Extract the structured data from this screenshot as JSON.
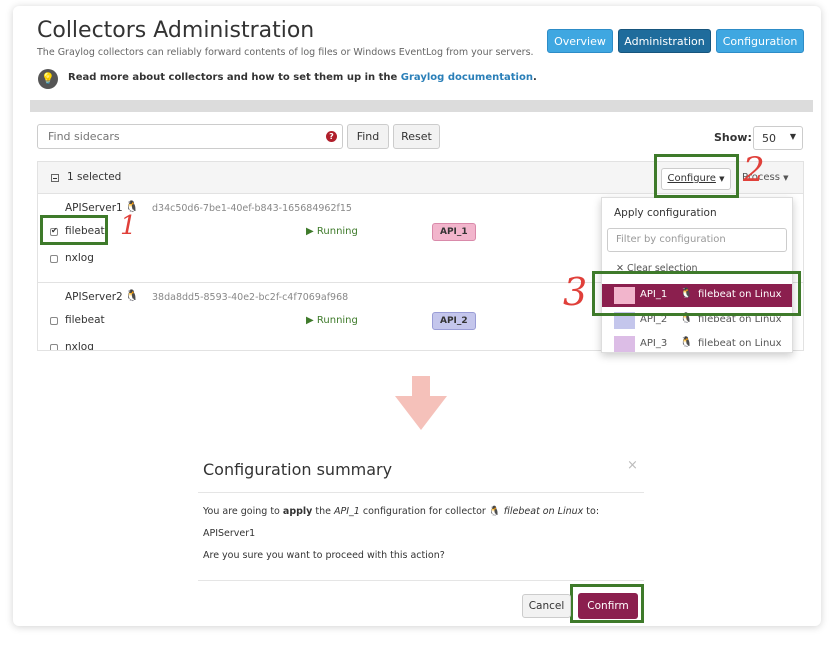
{
  "header": {
    "title": "Collectors Administration",
    "subtitle": "The Graylog collectors can reliably forward contents of log files or Windows EventLog from your servers.",
    "buttons": [
      "Overview",
      "Administration",
      "Configuration"
    ],
    "doc_text": "Read more about collectors and how to set them up in the",
    "doc_link": "Graylog documentation",
    "doc_suffix": "."
  },
  "search": {
    "placeholder": "Find sidecars",
    "find_label": "Find",
    "reset_label": "Reset"
  },
  "show": {
    "label": "Show:",
    "value": "50"
  },
  "list": {
    "selected_text": "1 selected",
    "configure_label": "Configure",
    "process_label": "Process",
    "servers": [
      {
        "name": "APIServer1",
        "id": "d34c50d6-7be1-40ef-b843-165684962f15",
        "collectors": [
          {
            "name": "filebeat",
            "checked": true,
            "status": "Running",
            "config": "API_1"
          },
          {
            "name": "nxlog",
            "checked": false
          }
        ]
      },
      {
        "name": "APIServer2",
        "id": "38da8dd5-8593-40e2-bc2f-c4f7069af968",
        "collectors": [
          {
            "name": "filebeat",
            "checked": false,
            "status": "Running",
            "config": "API_2"
          },
          {
            "name": "nxlog",
            "checked": false
          }
        ]
      }
    ]
  },
  "dropdown": {
    "header": "Apply configuration",
    "filter_placeholder": "Filter by configuration",
    "clear_label": "Clear selection",
    "items": [
      {
        "name": "API_1",
        "collector": "filebeat on Linux",
        "color": "#f2b5cc"
      },
      {
        "name": "API_2",
        "collector": "filebeat on Linux",
        "color": "#c4c6ec"
      },
      {
        "name": "API_3",
        "collector": "filebeat on Linux",
        "color": "#dcbde6"
      }
    ]
  },
  "annotations": [
    "1",
    "2",
    "3"
  ],
  "modal": {
    "title": "Configuration summary",
    "close": "×",
    "text_1a": "You are going to",
    "text_1b": "apply",
    "text_1c": "the",
    "text_1d": "API_1",
    "text_1e": "configuration for collector",
    "text_1f": "filebeat on Linux",
    "text_1g": "to:",
    "server": "APIServer1",
    "question": "Are you sure you want to proceed with this action?",
    "cancel_label": "Cancel",
    "confirm_label": "Confirm"
  },
  "colors": {
    "primary_blue": "#3fa7e1",
    "active_blue": "#1f6c9c",
    "highlight_green": "#3e7a2a",
    "annotation_red": "#e0403a",
    "selected_purple": "#8b1f4e",
    "arrow_pink": "#f5c1ba"
  }
}
